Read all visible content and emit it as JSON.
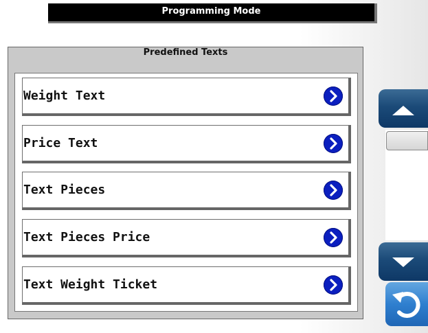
{
  "header": {
    "title": "Programming Mode"
  },
  "panel": {
    "title": "Predefined Texts",
    "items": [
      {
        "label": "Weight Text"
      },
      {
        "label": "Price Text"
      },
      {
        "label": "Text Pieces"
      },
      {
        "label": "Text Pieces Price"
      },
      {
        "label": "Text Weight Ticket"
      }
    ]
  },
  "icons": {
    "item_action": "chevron-right-icon",
    "scroll_up": "arrow-up-icon",
    "scroll_down": "arrow-down-icon",
    "back": "back-arrow-icon"
  },
  "colors": {
    "header_bg": "#000000",
    "chevron_bg": "#0b1fbf",
    "scroll_button": "#1b4a78",
    "back_button": "#2f7fcf"
  }
}
